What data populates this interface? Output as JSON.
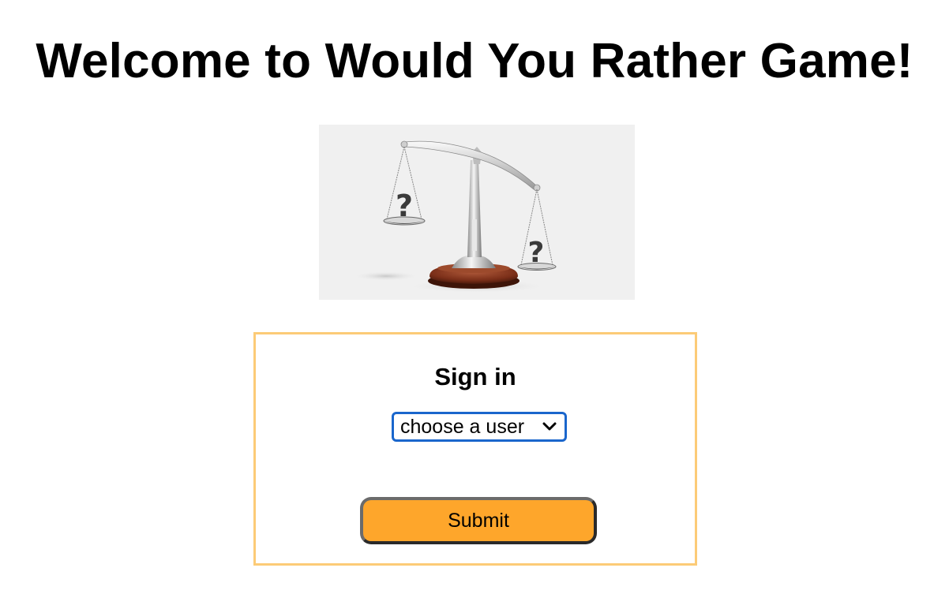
{
  "page": {
    "title": "Welcome to Would You Rather Game!"
  },
  "hero": {
    "image": "balance-scale-with-question-marks",
    "question_marks": [
      "?",
      "?"
    ]
  },
  "signin": {
    "heading": "Sign in",
    "user_select": {
      "selected": "choose a user",
      "icon": "chevron-down-icon"
    },
    "submit_label": "Submit"
  },
  "colors": {
    "box_border": "#fccb77",
    "select_border": "#1a66cc",
    "button_bg": "#fea62b",
    "hero_bg": "#f0f0f0"
  }
}
